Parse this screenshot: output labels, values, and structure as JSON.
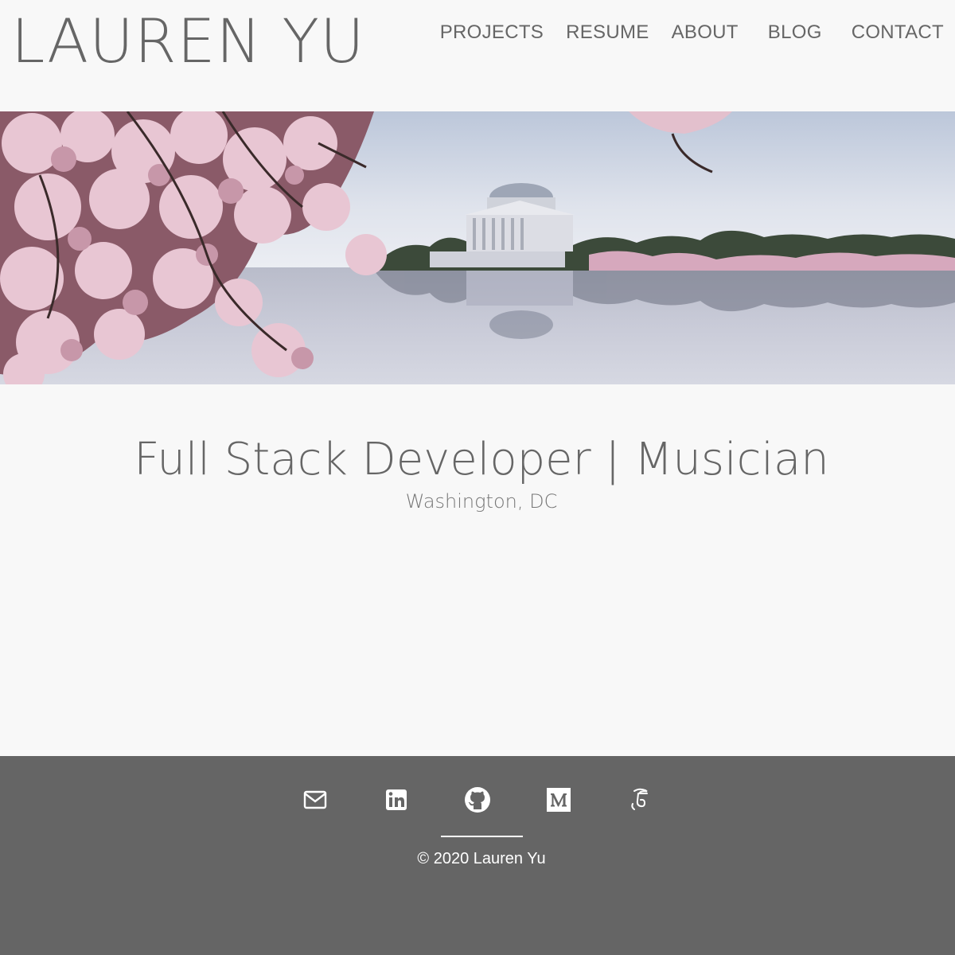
{
  "header": {
    "site_title": "LAUREN YU",
    "nav": [
      {
        "label": "PROJECTS"
      },
      {
        "label": "RESUME"
      },
      {
        "label": "ABOUT"
      },
      {
        "label": "BLOG"
      },
      {
        "label": "CONTACT"
      }
    ]
  },
  "hero": {
    "image": "cherry-blossoms-jefferson-memorial"
  },
  "main": {
    "tagline": "Full Stack Developer | Musician",
    "location": "Washington, DC"
  },
  "footer": {
    "social": [
      {
        "icon": "email-icon"
      },
      {
        "icon": "linkedin-icon"
      },
      {
        "icon": "github-icon"
      },
      {
        "icon": "medium-icon"
      },
      {
        "icon": "freecodecamp-icon"
      }
    ],
    "copyright": "© 2020 Lauren Yu"
  },
  "colors": {
    "background": "#f8f8f8",
    "text": "#666666",
    "footer": "#656565"
  }
}
